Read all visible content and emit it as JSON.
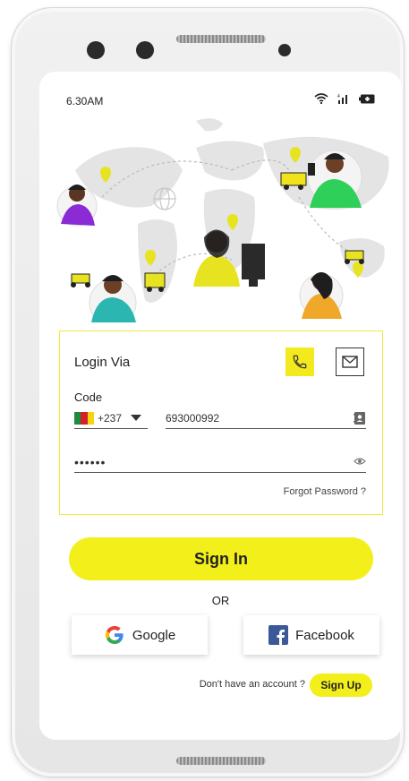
{
  "status_bar": {
    "time": "6.30AM"
  },
  "login": {
    "title": "Login Via",
    "code_label": "Code",
    "country_code": "+237",
    "phone_number": "693000992",
    "password_masked": "••••••",
    "forgot_password": "Forgot Password ?"
  },
  "actions": {
    "sign_in": "Sign In",
    "or": "OR",
    "google": "Google",
    "facebook": "Facebook",
    "no_account": "Don't have an account ?",
    "sign_up": "Sign Up"
  },
  "colors": {
    "accent": "#f2ef1b",
    "card_border": "#f0ea3a",
    "facebook": "#3b5998",
    "flag_green": "#1c8c3a",
    "flag_red": "#d3212c",
    "flag_yellow": "#f5d410"
  },
  "icons": {
    "wifi": "wifi-icon",
    "signal": "signal-icon",
    "battery": "battery-icon",
    "phone": "phone-icon",
    "mail": "mail-icon",
    "contact": "contact-book-icon",
    "eye": "eye-icon",
    "dropdown": "caret-down-icon",
    "google": "google-logo-icon",
    "facebook": "facebook-logo-icon"
  }
}
